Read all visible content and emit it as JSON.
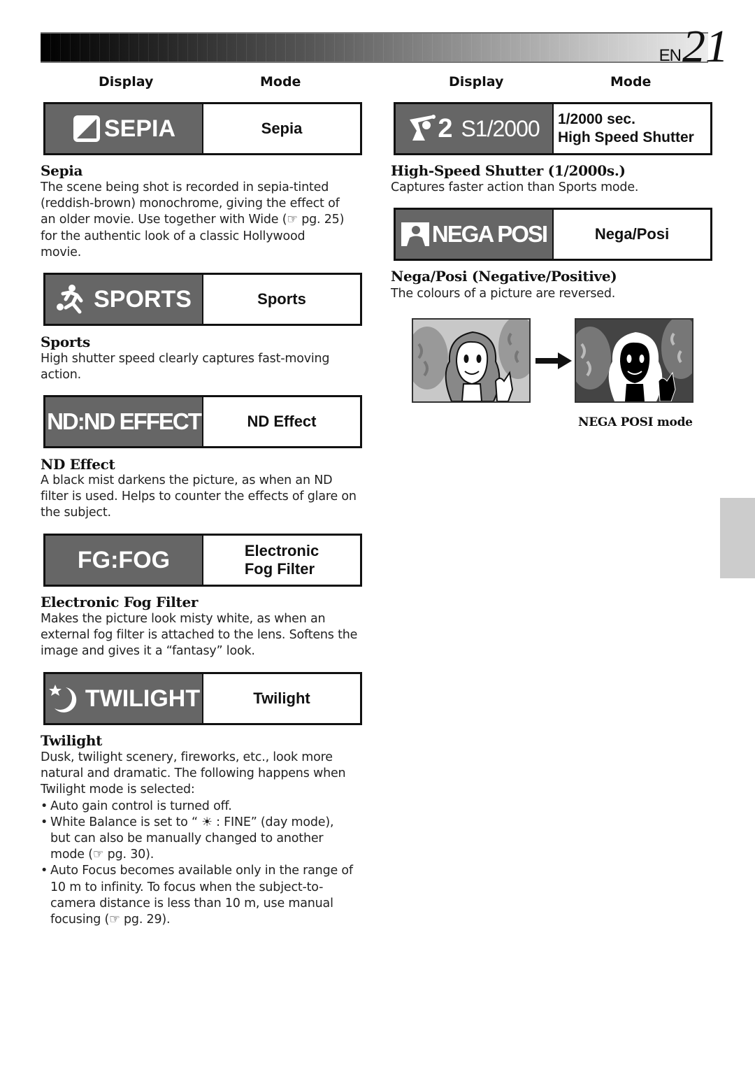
{
  "page": {
    "language_code": "EN",
    "page_number": "21"
  },
  "columns": {
    "left": {
      "display_header": "Display",
      "mode_header": "Mode"
    },
    "right": {
      "display_header": "Display",
      "mode_header": "Mode"
    }
  },
  "modes": {
    "sepia": {
      "display_icon": "sepia-half-square-icon",
      "display_text": "SEPIA",
      "mode_label": "Sepia",
      "title": "Sepia",
      "body": "The scene being shot is recorded in sepia-tinted (reddish-brown) monochrome, giving the effect of an older movie. Use together with Wide (☞ pg. 25) for the authentic look of a classic Hollywood movie.",
      "body_lines": [
        "The scene being shot is recorded in sepia-tinted",
        "(reddish-brown) monochrome, giving the effect of",
        "an older movie. Use together with Wide (☞ pg. 25)",
        "for the authentic look of a classic Hollywood",
        "movie."
      ]
    },
    "sports": {
      "display_icon": "running-figure-icon",
      "display_text": "SPORTS",
      "mode_label": "Sports",
      "title": "Sports",
      "body_lines": [
        "High shutter speed clearly captures fast-moving",
        "action."
      ]
    },
    "nd_effect": {
      "display_text": "ND:ND EFFECT",
      "mode_label": "ND Effect",
      "title": "ND Effect",
      "body_lines": [
        "A black mist darkens the picture, as when an ND",
        "filter is used. Helps to counter the effects of glare on",
        "the subject."
      ]
    },
    "fog": {
      "display_text": "FG:FOG",
      "mode_label_line1": "Electronic",
      "mode_label_line2": "Fog Filter",
      "title": "Electronic Fog Filter",
      "body_lines": [
        "Makes the picture look misty white, as when an",
        "external fog filter is attached to the lens. Softens the",
        "image and gives it a “fantasy” look."
      ]
    },
    "twilight": {
      "display_icon": "moon-star-icon",
      "display_text": "TWILIGHT",
      "mode_label": "Twilight",
      "title": "Twilight",
      "intro_lines": [
        "Dusk, twilight scenery, fireworks, etc., look more",
        "natural and dramatic. The following happens when",
        "Twilight mode is selected:"
      ],
      "bullets": [
        {
          "lines": [
            "Auto gain control is turned off."
          ]
        },
        {
          "lines": [
            "White Balance is set to “ ☀ : FINE” (day mode),",
            "but can also be manually changed to another",
            "mode (☞ pg. 30)."
          ]
        },
        {
          "lines": [
            "Auto Focus becomes available only in the range of",
            "10 m to infinity. To focus when the subject-to-",
            "camera distance is less than 10 m, use manual",
            "focusing (☞ pg. 29)."
          ]
        }
      ]
    },
    "shutter": {
      "display_icon": "golfer-icon",
      "display_prefix": "2",
      "display_text": "S1/2000",
      "mode_label_line1": "1/2000 sec.",
      "mode_label_line2": "High Speed Shutter",
      "title": "High-Speed Shutter (1/2000s.)",
      "body_lines": [
        "Captures faster action than Sports mode."
      ]
    },
    "nega_posi": {
      "display_icon": "portrait-person-icon",
      "display_text": "NEGA POSI",
      "mode_label": "Nega/Posi",
      "title": "Nega/Posi (Negative/Positive)",
      "body_lines": [
        "The colours of a picture are reversed."
      ],
      "illustration_caption": "NEGA POSI mode"
    }
  },
  "colors": {
    "display_bg": "#666666",
    "side_tab": "#cccccc"
  }
}
